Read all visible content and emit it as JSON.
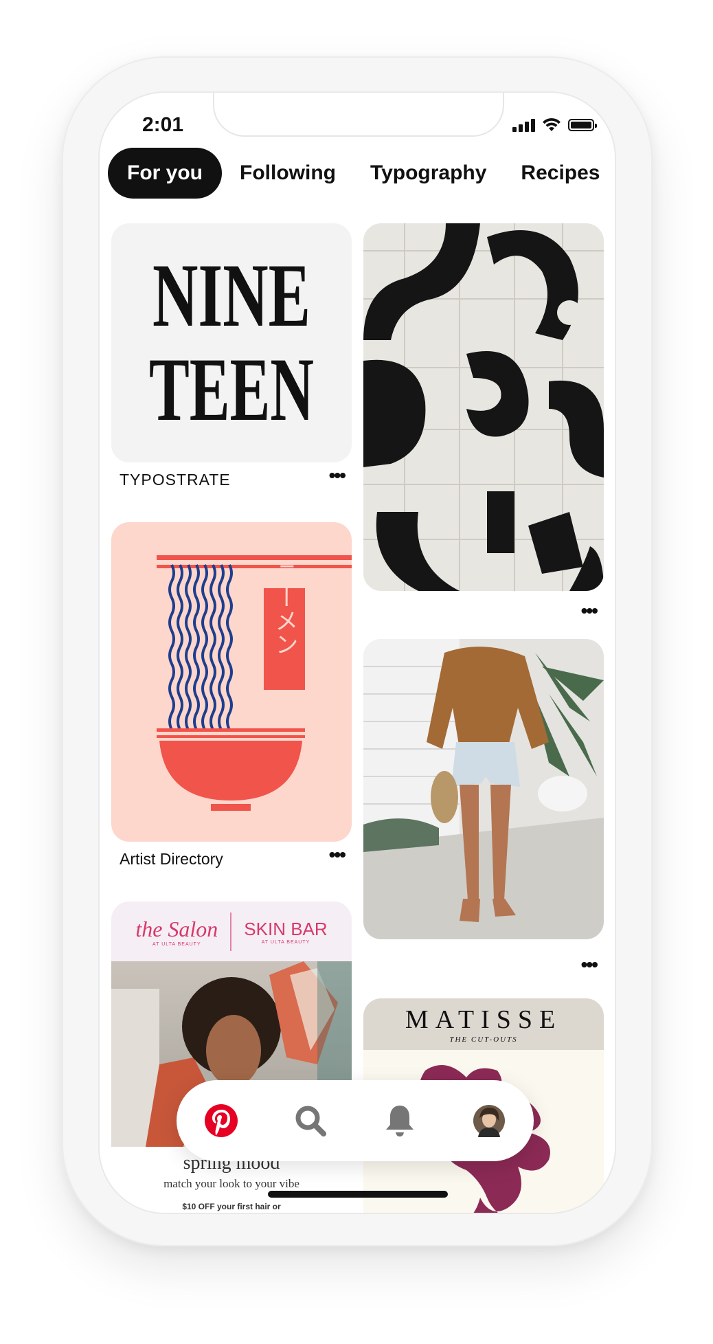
{
  "status_bar": {
    "time": "2:01"
  },
  "tabs": [
    {
      "label": "For you",
      "active": true
    },
    {
      "label": "Following",
      "active": false
    },
    {
      "label": "Typography",
      "active": false
    },
    {
      "label": "Recipes",
      "active": false
    }
  ],
  "pins": {
    "nine_teen": {
      "art_line1": "NINE",
      "art_line2": "TEEN",
      "title": "TYPOSTRATE",
      "menu": "•••"
    },
    "ramen": {
      "art_text": "ラーメン",
      "title": "Artist Directory",
      "menu": "•••"
    },
    "salon": {
      "brand1": "the Salon",
      "brand1_sub": "AT ULTA BEAUTY",
      "brand2": "SKIN BAR",
      "brand2_sub": "AT ULTA BEAUTY",
      "headline": "spring mood",
      "tagline": "match your look to your vibe",
      "offer": "$10 OFF your first hair or"
    },
    "abstract": {
      "menu": "•••"
    },
    "fashion": {
      "menu": "•••"
    },
    "matisse": {
      "title": "MATISSE",
      "subtitle": "THE CUT-OUTS"
    }
  },
  "bottom_nav": {
    "items": [
      "home-icon",
      "search-icon",
      "notifications-icon",
      "profile-avatar"
    ]
  },
  "colors": {
    "pinterest_red": "#e60023",
    "ramen_red": "#f1544a",
    "ramen_blue": "#1e3e8e",
    "matisse_plum": "#8b2a55"
  }
}
